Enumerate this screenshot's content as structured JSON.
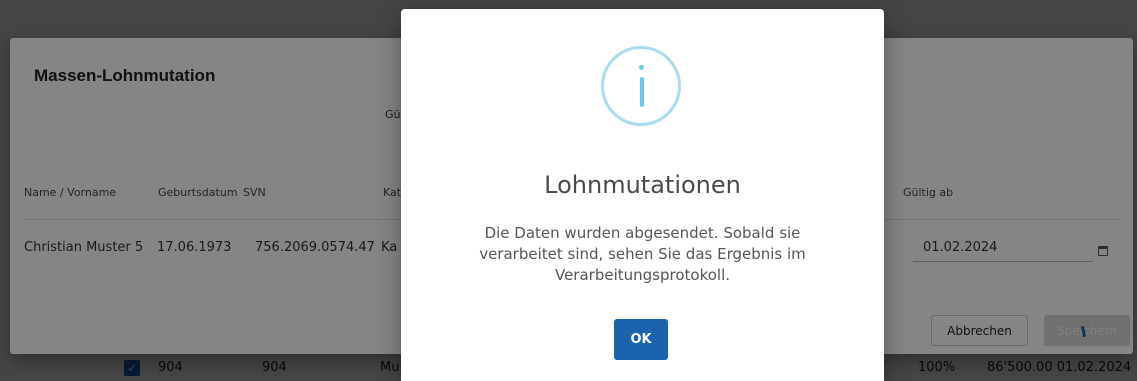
{
  "background_row": {
    "checkbox_glyph": "✓",
    "col1": "904",
    "col2": "904",
    "col3": "Mu",
    "percent": "100%",
    "amount_date": "86'500.00 01.02.2024"
  },
  "mass_dialog": {
    "title": "Massen-Lohnmutation",
    "gueltig_partial": "Gü",
    "columns": {
      "name": "Name / Vorname",
      "birthdate": "Geburtsdatum",
      "svn": "SVN",
      "kat": "Kat",
      "valid_from": "Gültig ab"
    },
    "row": {
      "name": "Christian Muster 5",
      "birthdate": "17.06.1973",
      "svn": "756.2069.0574.47",
      "kat": "Ka",
      "valid_from": "01.02.2024"
    },
    "calendar_icon": "calendar-icon",
    "cancel_label": "Abbrechen",
    "save_label": "Speichern"
  },
  "modal": {
    "icon": "info-icon",
    "icon_color": "#6ec6e8",
    "title": "Lohnmutationen",
    "message": "Die Daten wurden abgesendet. Sobald sie verarbeitet sind, sehen Sie das Ergebnis im Verarbeitungsprotokoll.",
    "ok_label": "OK",
    "ok_color": "#1b63ad"
  }
}
